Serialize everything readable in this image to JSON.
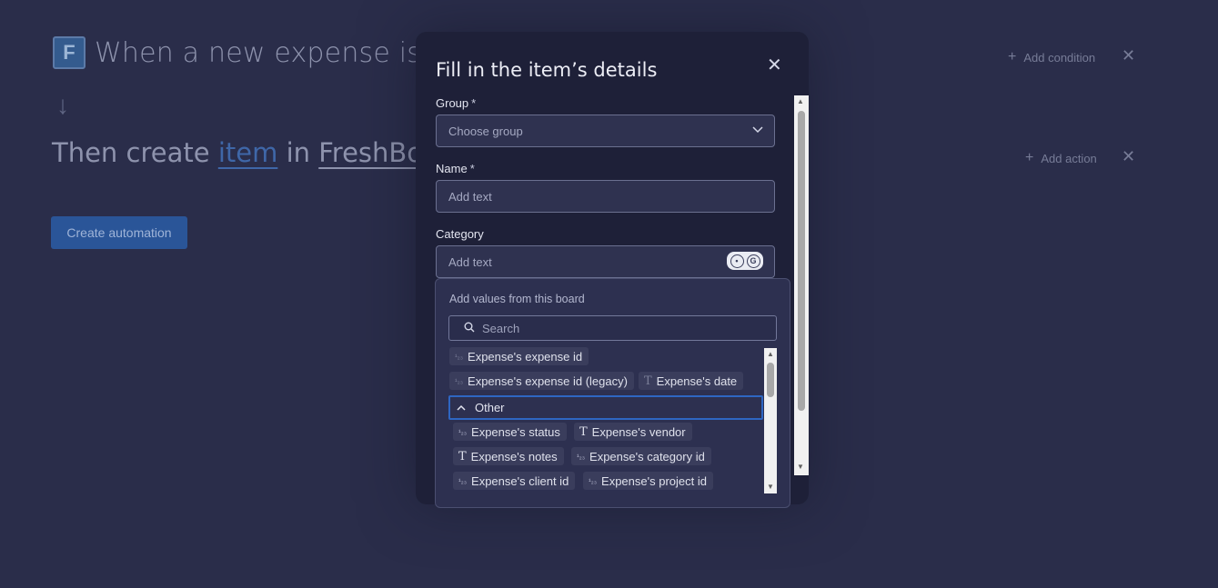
{
  "background": {
    "trigger_text": "When a new expense is cr",
    "action_prefix": "Then create",
    "action_item_link": "item",
    "action_in": "in",
    "action_board_link": "FreshBoo",
    "add_condition_label": "Add condition",
    "add_action_label": "Add action",
    "create_button_label": "Create automation",
    "logo_letter": "F"
  },
  "modal": {
    "title": "Fill in the item’s details",
    "fields": {
      "group": {
        "label": "Group",
        "required_mark": "*",
        "placeholder": "Choose group"
      },
      "name": {
        "label": "Name",
        "required_mark": "*",
        "placeholder": "Add text"
      },
      "category": {
        "label": "Category",
        "placeholder": "Add text"
      }
    }
  },
  "dropdown": {
    "heading": "Add values from this board",
    "search_placeholder": "Search",
    "top_chips": [
      {
        "label": "Expense's expense id",
        "icon": "numbers-icon"
      },
      {
        "label": "Expense's expense id (legacy)",
        "icon": "numbers-icon"
      },
      {
        "label": "Expense's date",
        "icon": "text-icon"
      }
    ],
    "section_label": "Other",
    "other_chips": [
      {
        "label": "Expense's status",
        "icon": "numbers-icon"
      },
      {
        "label": "Expense's vendor",
        "icon": "text-icon"
      },
      {
        "label": "Expense's notes",
        "icon": "text-icon"
      },
      {
        "label": "Expense's category id",
        "icon": "numbers-icon"
      },
      {
        "label": "Expense's client id",
        "icon": "numbers-icon"
      },
      {
        "label": "Expense's project id",
        "icon": "numbers-icon"
      }
    ]
  },
  "colors": {
    "page_bg": "#2a2d4a",
    "modal_bg": "#1e2038",
    "accent": "#2e66c2"
  }
}
